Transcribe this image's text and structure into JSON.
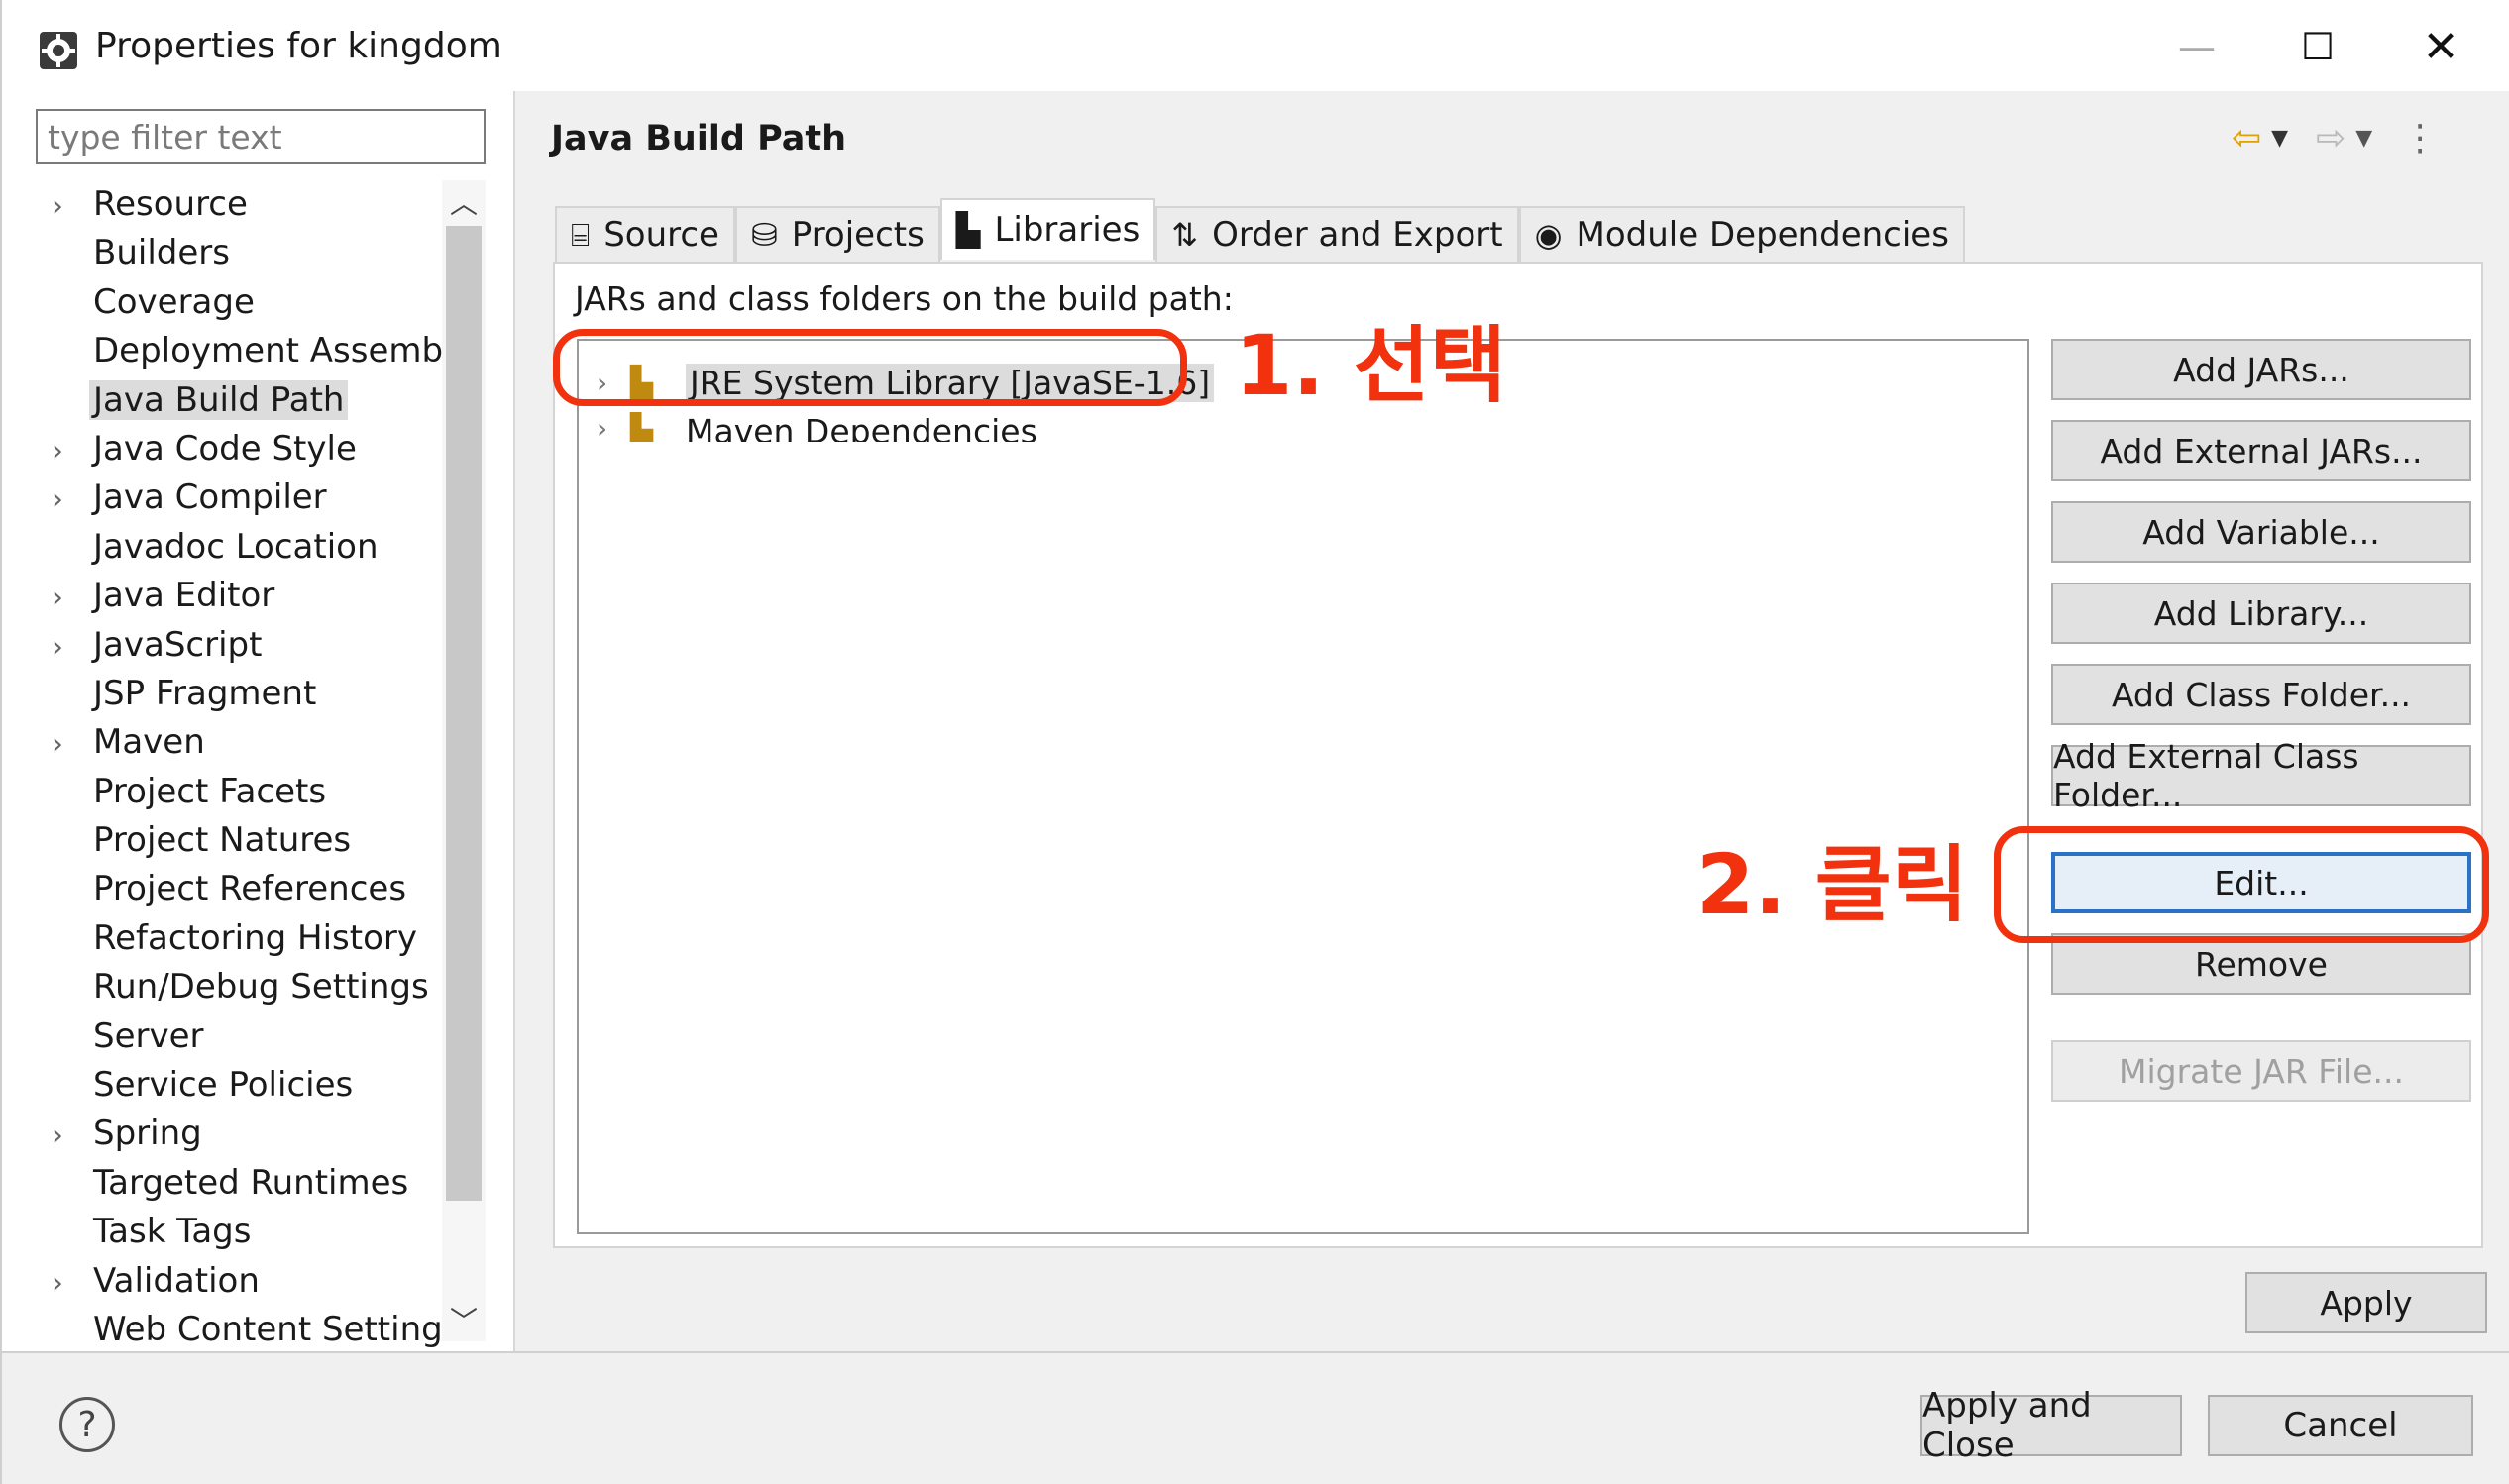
{
  "window": {
    "title": "Properties for kingdom",
    "minimize_glyph": "—",
    "maximize_glyph": "☐",
    "close_glyph": "✕"
  },
  "left": {
    "filter_placeholder": "type filter text",
    "tree": [
      {
        "label": "Resource",
        "expandable": true
      },
      {
        "label": "Builders",
        "expandable": false
      },
      {
        "label": "Coverage",
        "expandable": false
      },
      {
        "label": "Deployment Assembly",
        "expandable": false
      },
      {
        "label": "Java Build Path",
        "expandable": false,
        "selected": true
      },
      {
        "label": "Java Code Style",
        "expandable": true
      },
      {
        "label": "Java Compiler",
        "expandable": true
      },
      {
        "label": "Javadoc Location",
        "expandable": false
      },
      {
        "label": "Java Editor",
        "expandable": true
      },
      {
        "label": "JavaScript",
        "expandable": true
      },
      {
        "label": "JSP Fragment",
        "expandable": false
      },
      {
        "label": "Maven",
        "expandable": true
      },
      {
        "label": "Project Facets",
        "expandable": false
      },
      {
        "label": "Project Natures",
        "expandable": false
      },
      {
        "label": "Project References",
        "expandable": false
      },
      {
        "label": "Refactoring History",
        "expandable": false
      },
      {
        "label": "Run/Debug Settings",
        "expandable": false
      },
      {
        "label": "Server",
        "expandable": false
      },
      {
        "label": "Service Policies",
        "expandable": false
      },
      {
        "label": "Spring",
        "expandable": true
      },
      {
        "label": "Targeted Runtimes",
        "expandable": false
      },
      {
        "label": "Task Tags",
        "expandable": false
      },
      {
        "label": "Validation",
        "expandable": true
      },
      {
        "label": "Web Content Settings",
        "expandable": false
      }
    ]
  },
  "right": {
    "title": "Java Build Path",
    "tabs": [
      {
        "label": "Source",
        "icon": "source-folder-icon",
        "glyph": "⌸"
      },
      {
        "label": "Projects",
        "icon": "projects-folder-icon",
        "glyph": "⛁"
      },
      {
        "label": "Libraries",
        "icon": "libraries-icon",
        "glyph": "▙",
        "active": true
      },
      {
        "label": "Order and Export",
        "icon": "order-export-icon",
        "glyph": "⇅"
      },
      {
        "label": "Module Dependencies",
        "icon": "module-icon",
        "glyph": "◉"
      }
    ],
    "path_label": "JARs and class folders on the build path:",
    "libraries": [
      {
        "label": "JRE System Library [JavaSE-1.6]",
        "selected": true
      },
      {
        "label": "Maven Dependencies",
        "selected": false
      }
    ],
    "buttons": {
      "add_jars": "Add JARs...",
      "add_external_jars": "Add External JARs...",
      "add_variable": "Add Variable...",
      "add_library": "Add Library...",
      "add_class_folder": "Add Class Folder...",
      "add_external_class_folder": "Add External Class Folder...",
      "edit": "Edit...",
      "remove": "Remove",
      "migrate_jar": "Migrate JAR File..."
    },
    "apply": "Apply"
  },
  "bottom": {
    "help_glyph": "?",
    "apply_and_close": "Apply and Close",
    "cancel": "Cancel"
  },
  "annotations": {
    "step1": "1. 선택",
    "step2": "2. 클릭",
    "color": "#f2320f"
  }
}
